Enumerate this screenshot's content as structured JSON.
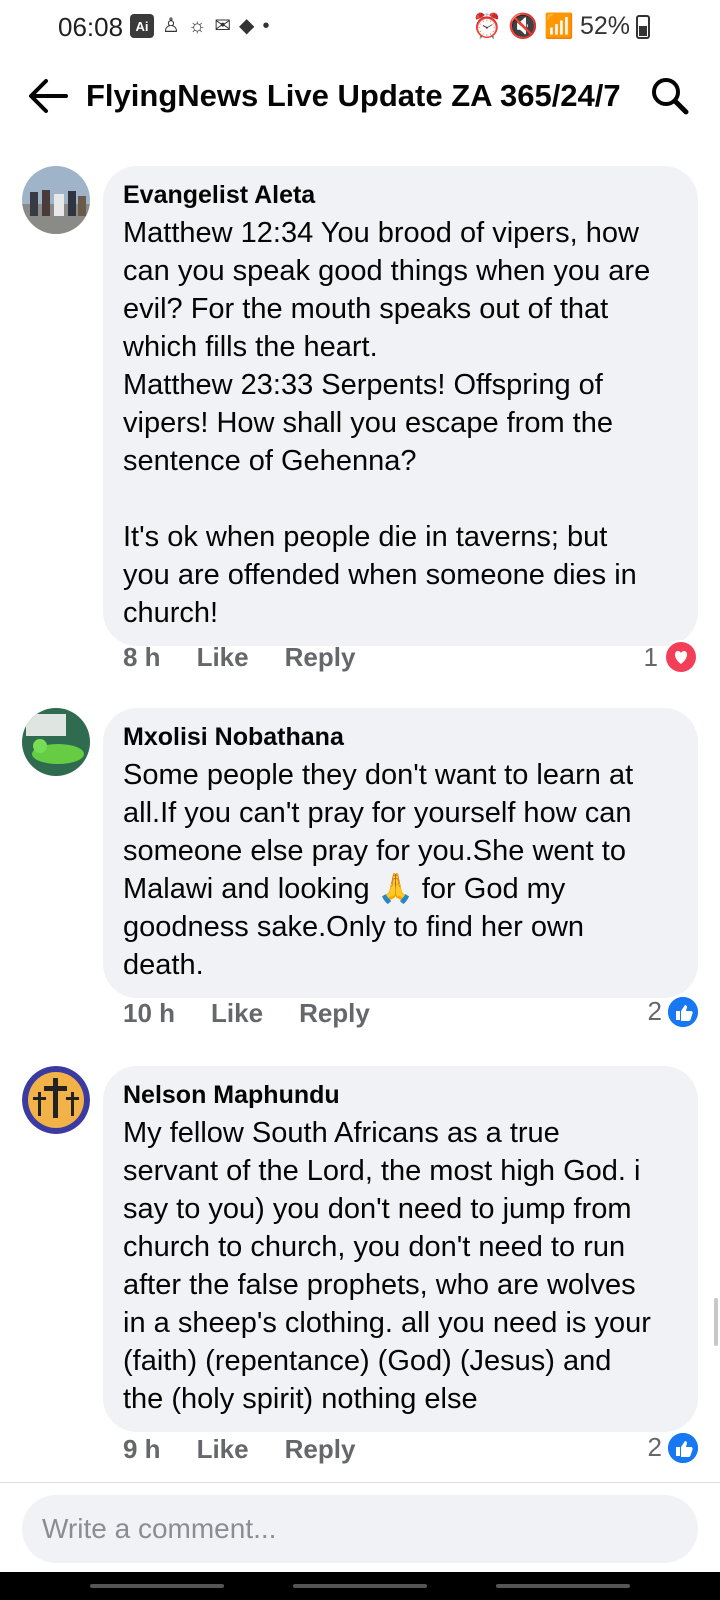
{
  "status_bar": {
    "time": "06:08",
    "ai_badge": "Ai",
    "battery_percent": "52%"
  },
  "header": {
    "title": "FlyingNews Live Update ZA 365/24/7",
    "back_icon": "arrow-left-icon",
    "search_icon": "search-icon"
  },
  "comments": [
    {
      "author": "Evangelist Aleta",
      "text": "Matthew 12:34 You brood of vipers, how\ncan you speak good things when you are\nevil? For the mouth speaks out of that\nwhich fills the heart.\nMatthew 23:33 Serpents! Offspring of\nvipers! How shall you escape from the\nsentence of Gehenna?\n\nIt's ok when people die in taverns; but\nyou are offended when someone dies in\nchurch!",
      "time": "8 h",
      "like_label": "Like",
      "reply_label": "Reply",
      "reaction_count": "1",
      "reaction_type": "love"
    },
    {
      "author": "Mxolisi Nobathana",
      "text": "Some people they don't want to learn at\nall.If you can't pray for yourself how can\nsomeone else pray for you.She went to\nMalawi and looking 🙏 for God my\ngoodness sake.Only to find her own\ndeath.",
      "time": "10 h",
      "like_label": "Like",
      "reply_label": "Reply",
      "reaction_count": "2",
      "reaction_type": "like"
    },
    {
      "author": "Nelson Maphundu",
      "text": "My fellow South Africans as a true\nservant of the Lord, the most high God. i\nsay to you) you don't need to jump from\nchurch to church, you don't need to run\nafter the false prophets, who are wolves\nin a sheep's clothing. all you need is your\n(faith) (repentance) (God) (Jesus) and\nthe (holy spirit) nothing else",
      "time": "9 h",
      "like_label": "Like",
      "reply_label": "Reply",
      "reaction_count": "2",
      "reaction_type": "like"
    }
  ],
  "composer": {
    "placeholder": "Write a comment..."
  },
  "colors": {
    "bubble_bg": "#f0f2f5",
    "meta_text": "#65676b",
    "like_blue": "#1877f2",
    "love_red": "#f33e58"
  }
}
